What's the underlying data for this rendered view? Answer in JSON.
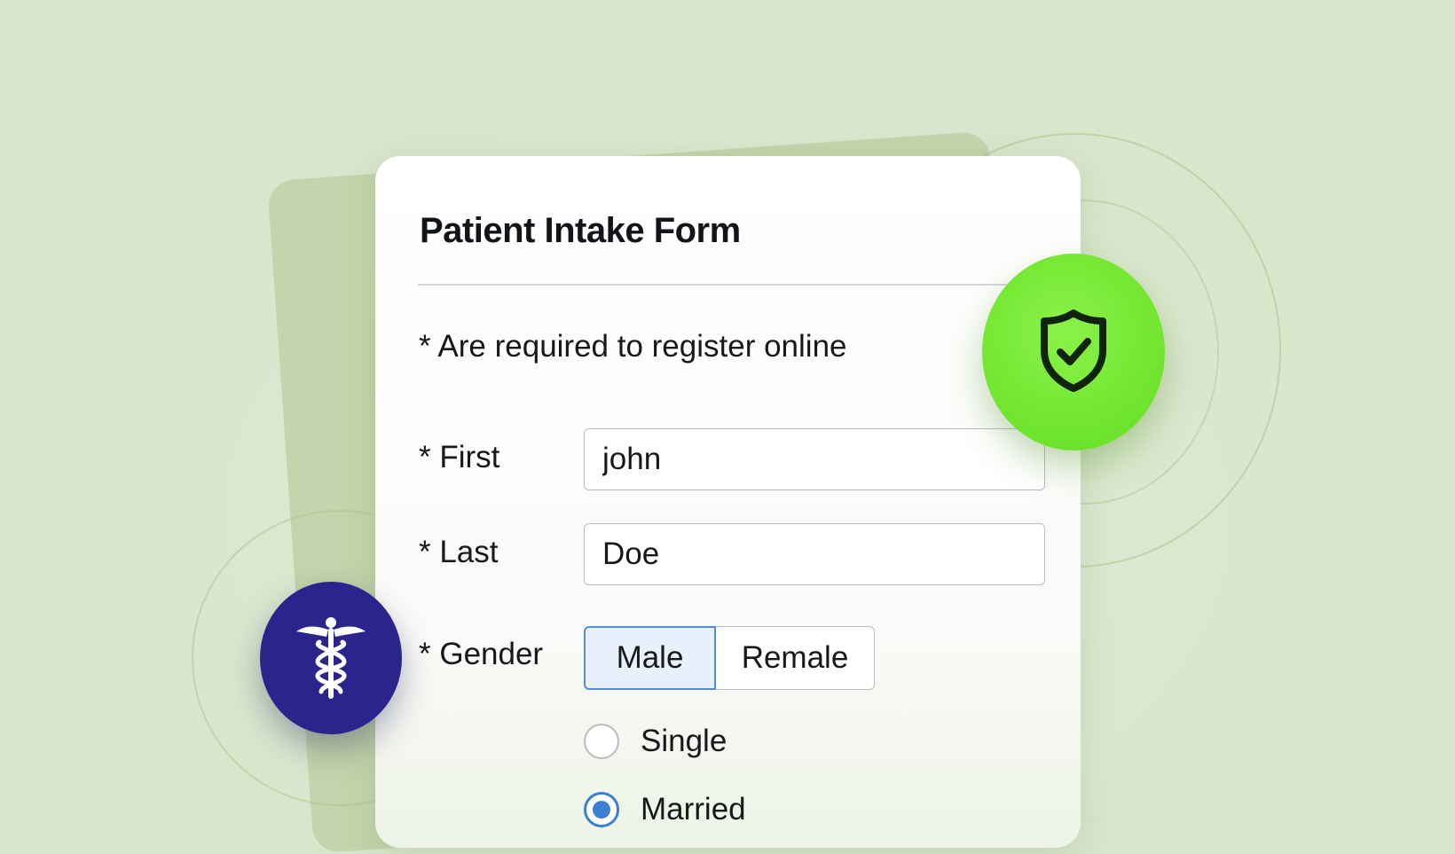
{
  "form": {
    "title": "Patient Intake Form",
    "note": "* Are required to register online",
    "first": {
      "label": "* First",
      "value": "john"
    },
    "last": {
      "label": "* Last",
      "value": "Doe"
    },
    "gender": {
      "label": "* Gender",
      "options": [
        "Male",
        "Remale"
      ],
      "selected": "Male"
    },
    "marital": {
      "options": [
        "Single",
        "Married"
      ],
      "selected": "Married"
    }
  },
  "badges": {
    "security": {
      "icon": "shield-check-icon",
      "color": "#6fe42c"
    },
    "medical": {
      "icon": "caduceus-icon",
      "color": "#2a248c"
    }
  },
  "colors": {
    "background": "#d9e6cc",
    "accent": "#4f8fd6"
  }
}
